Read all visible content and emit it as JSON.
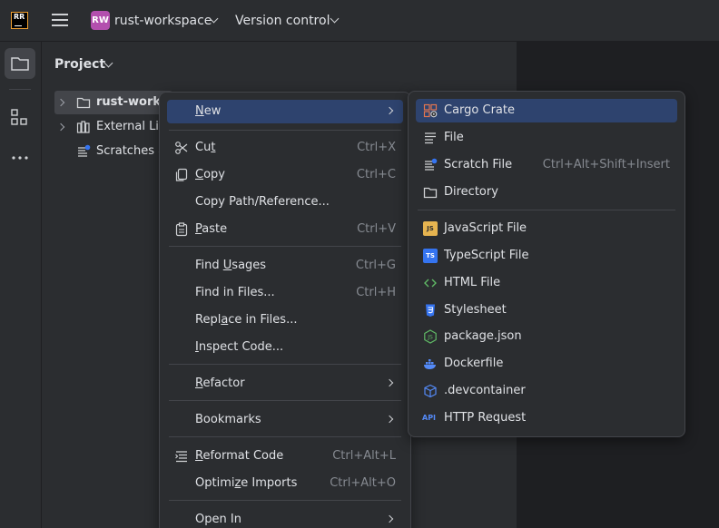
{
  "titlebar": {
    "app_logo": "RR",
    "project_initials": "RW",
    "project_name": "rust-workspace",
    "vcs_label": "Version control",
    "colors": {
      "project_badge": "#b34fae",
      "logo_accent": "#f0a030"
    }
  },
  "project_panel": {
    "title": "Project",
    "tree": [
      {
        "label": "rust-works",
        "icon": "folder-icon",
        "expanded": false
      },
      {
        "label": "External Lib",
        "icon": "library-icon",
        "expanded": false
      },
      {
        "label": "Scratches a",
        "icon": "scratches-icon"
      }
    ]
  },
  "context_menu": {
    "items": [
      {
        "pre": "",
        "key": "N",
        "post": "ew",
        "shortcut": "",
        "submenu": true,
        "icon": ""
      },
      {
        "pre": "Cu",
        "key": "t",
        "post": "",
        "shortcut": "Ctrl+X",
        "icon": "scissors-icon"
      },
      {
        "pre": "",
        "key": "C",
        "post": "opy",
        "shortcut": "Ctrl+C",
        "icon": "copy-icon"
      },
      {
        "pre": "Copy Path/Reference...",
        "key": "",
        "post": "",
        "shortcut": ""
      },
      {
        "pre": "",
        "key": "P",
        "post": "aste",
        "shortcut": "Ctrl+V",
        "icon": "paste-icon"
      },
      {
        "pre": "Find ",
        "key": "U",
        "post": "sages",
        "shortcut": "Ctrl+G"
      },
      {
        "pre": "Find in Files...",
        "key": "",
        "post": "",
        "shortcut": "Ctrl+H"
      },
      {
        "pre": "Repl",
        "key": "a",
        "post": "ce in Files...",
        "shortcut": ""
      },
      {
        "pre": "",
        "key": "I",
        "post": "nspect Code...",
        "shortcut": ""
      },
      {
        "pre": "",
        "key": "R",
        "post": "efactor",
        "shortcut": "",
        "submenu": true
      },
      {
        "pre": "Bookmarks",
        "key": "",
        "post": "",
        "shortcut": "",
        "submenu": true
      },
      {
        "pre": "",
        "key": "R",
        "post": "eformat Code",
        "shortcut": "Ctrl+Alt+L",
        "icon": "reformat-icon"
      },
      {
        "pre": "Optimi",
        "key": "z",
        "post": "e Imports",
        "shortcut": "Ctrl+Alt+O"
      },
      {
        "pre": "Open In",
        "key": "",
        "post": "",
        "shortcut": "",
        "submenu": true
      }
    ]
  },
  "new_submenu": {
    "items": [
      {
        "label": "Cargo Crate",
        "shortcut": "",
        "icon": "cargo-crate-icon"
      },
      {
        "label": "File",
        "shortcut": "",
        "icon": "file-icon"
      },
      {
        "label": "Scratch File",
        "shortcut": "Ctrl+Alt+Shift+Insert",
        "icon": "scratch-file-icon"
      },
      {
        "label": "Directory",
        "shortcut": "",
        "icon": "directory-icon"
      },
      {
        "label": "JavaScript File",
        "shortcut": "",
        "icon": "javascript-icon",
        "badge": "JS"
      },
      {
        "label": "TypeScript File",
        "shortcut": "",
        "icon": "typescript-icon",
        "badge": "TS"
      },
      {
        "label": "HTML File",
        "shortcut": "",
        "icon": "html-icon"
      },
      {
        "label": "Stylesheet",
        "shortcut": "",
        "icon": "css-icon"
      },
      {
        "label": "package.json",
        "shortcut": "",
        "icon": "nodejs-icon"
      },
      {
        "label": "Dockerfile",
        "shortcut": "",
        "icon": "docker-icon"
      },
      {
        "label": ".devcontainer",
        "shortcut": "",
        "icon": "devcontainer-icon"
      },
      {
        "label": "HTTP Request",
        "shortcut": "",
        "icon": "http-request-icon",
        "badge": "API"
      }
    ]
  }
}
